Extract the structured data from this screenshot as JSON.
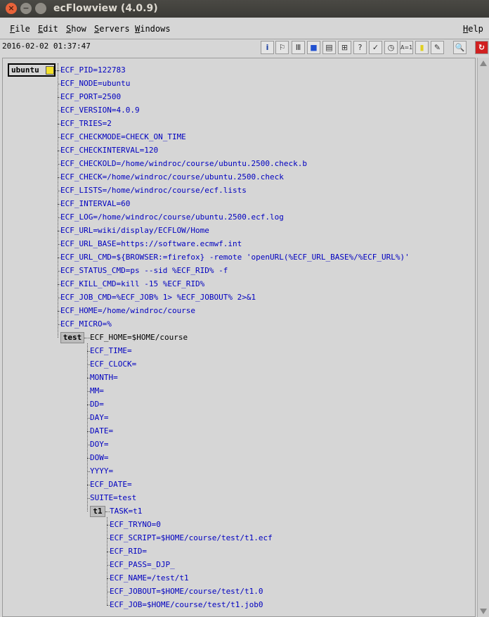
{
  "window": {
    "title": "ecFlowview (4.0.9)"
  },
  "menu": [
    {
      "label": "File",
      "u": "F",
      "rest": "ile"
    },
    {
      "label": "Edit",
      "u": "E",
      "rest": "dit"
    },
    {
      "label": "Show",
      "u": "S",
      "rest": "how"
    },
    {
      "label": "Servers",
      "u": "S",
      "rest": "ervers"
    },
    {
      "label": "Windows",
      "u": "W",
      "rest": "indows"
    },
    {
      "label": "Help",
      "u": "H",
      "rest": "elp"
    }
  ],
  "toolbar": {
    "timestamp": "2016-02-02 01:37:47",
    "buttons": [
      {
        "name": "info-icon",
        "glyph": "i"
      },
      {
        "name": "flag-icon",
        "glyph": "⚐"
      },
      {
        "name": "bars-icon",
        "glyph": "Ⅲ"
      },
      {
        "name": "colors-icon",
        "glyph": "■"
      },
      {
        "name": "doc-icon",
        "glyph": "▤"
      },
      {
        "name": "tree-icon",
        "glyph": "⊞"
      },
      {
        "name": "question-icon",
        "glyph": "?"
      },
      {
        "name": "check-icon",
        "glyph": "✓"
      },
      {
        "name": "clock-icon",
        "glyph": "◷"
      },
      {
        "name": "equal-icon",
        "glyph": "A=1"
      },
      {
        "name": "note-icon",
        "glyph": "▮"
      },
      {
        "name": "pencil-icon",
        "glyph": "✎"
      },
      {
        "name": "search-icon",
        "glyph": "🔍"
      },
      {
        "name": "refresh-icon",
        "glyph": "↻"
      }
    ]
  },
  "tree": {
    "server": {
      "label": "ubuntu",
      "vars": [
        "ECF_PID=122783",
        "ECF_NODE=ubuntu",
        "ECF_PORT=2500",
        "ECF_VERSION=4.0.9",
        "ECF_TRIES=2",
        "ECF_CHECKMODE=CHECK_ON_TIME",
        "ECF_CHECKINTERVAL=120",
        "ECF_CHECKOLD=/home/windroc/course/ubuntu.2500.check.b",
        "ECF_CHECK=/home/windroc/course/ubuntu.2500.check",
        "ECF_LISTS=/home/windroc/course/ecf.lists",
        "ECF_INTERVAL=60",
        "ECF_LOG=/home/windroc/course/ubuntu.2500.ecf.log",
        "ECF_URL=wiki/display/ECFLOW/Home",
        "ECF_URL_BASE=https://software.ecmwf.int",
        "ECF_URL_CMD=${BROWSER:=firefox} -remote 'openURL(%ECF_URL_BASE%/%ECF_URL%)'",
        "ECF_STATUS_CMD=ps --sid %ECF_RID% -f",
        "ECF_KILL_CMD=kill -15 %ECF_RID%",
        "ECF_JOB_CMD=%ECF_JOB% 1> %ECF_JOBOUT% 2>&1",
        "ECF_HOME=/home/windroc/course",
        "ECF_MICRO=%"
      ]
    },
    "suite": {
      "label": "test",
      "first_var": "ECF_HOME=$HOME/course",
      "vars": [
        "ECF_TIME=",
        "ECF_CLOCK=",
        "MONTH=",
        "MM=",
        "DD=",
        "DAY=",
        "DATE=",
        "DOY=",
        "DOW=",
        "YYYY=",
        "ECF_DATE=",
        "SUITE=test"
      ]
    },
    "task": {
      "label": "t1",
      "first_var": "TASK=t1",
      "vars": [
        "ECF_TRYNO=0",
        "ECF_SCRIPT=$HOME/course/test/t1.ecf",
        "ECF_RID=",
        "ECF_PASS=_DJP_",
        "ECF_NAME=/test/t1",
        "ECF_JOBOUT=$HOME/course/test/t1.0",
        "ECF_JOB=$HOME/course/test/t1.job0"
      ]
    }
  }
}
